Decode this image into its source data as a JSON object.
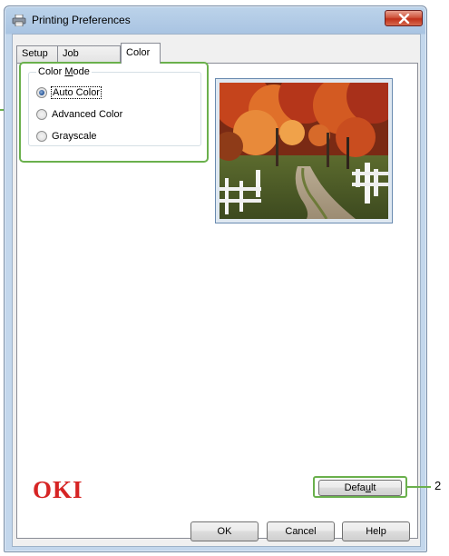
{
  "window": {
    "title": "Printing Preferences"
  },
  "tabs": [
    {
      "label": "Setup",
      "active": false
    },
    {
      "label": "Job Options",
      "active": false
    },
    {
      "label": "Color",
      "active": true
    }
  ],
  "color_mode": {
    "group_title_pre": "Color ",
    "group_title_mnemonic": "M",
    "group_title_post": "ode",
    "options": [
      {
        "label": "Auto Color",
        "checked": true
      },
      {
        "label": "Advanced Color",
        "checked": false
      },
      {
        "label": "Grayscale",
        "checked": false
      }
    ]
  },
  "brand": {
    "logo_text": "OKI",
    "logo_color": "#d62424"
  },
  "default_button": {
    "label_pre": "Defa",
    "label_mnemonic": "u",
    "label_post": "lt"
  },
  "callouts": {
    "right_number": "2",
    "highlight_color": "#6ab04c"
  },
  "footer": {
    "ok": "OK",
    "cancel": "Cancel",
    "help": "Help"
  }
}
